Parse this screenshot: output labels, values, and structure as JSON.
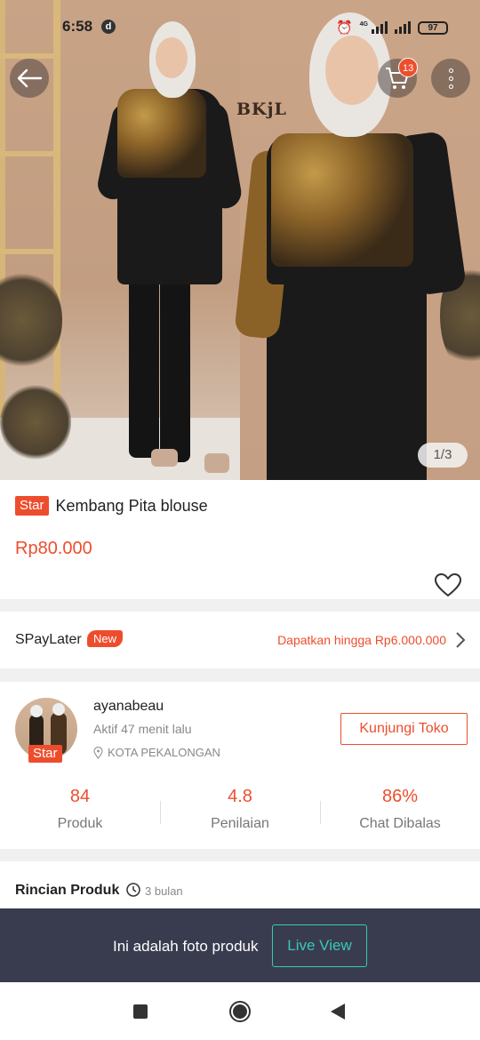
{
  "status_bar": {
    "time": "6:58",
    "notification_letter": "d",
    "network": "4G",
    "battery": "97"
  },
  "gallery": {
    "brand_mark": "BKjL",
    "counter": "1/3"
  },
  "header": {
    "cart_count": "13"
  },
  "product": {
    "badge": "Star",
    "title": "Kembang Pita blouse",
    "price": "Rp80.000"
  },
  "spaylater": {
    "label": "SPayLater",
    "badge": "New",
    "promo": "Dapatkan hingga Rp6.000.000"
  },
  "shop": {
    "name": "ayanabeau",
    "badge": "Star",
    "active": "Aktif 47 menit lalu",
    "location": "KOTA PEKALONGAN",
    "visit_label": "Kunjungi Toko",
    "stats": [
      {
        "value": "84",
        "label": "Produk"
      },
      {
        "value": "4.8",
        "label": "Penilaian"
      },
      {
        "value": "86%",
        "label": "Chat Dibalas"
      }
    ]
  },
  "details": {
    "title": "Rincian Produk",
    "age": "3 bulan"
  },
  "live_banner": {
    "text": "Ini adalah foto produk",
    "button": "Live View"
  },
  "colors": {
    "accent": "#ee4d2d",
    "banner_bg": "#393c4f",
    "live_teal": "#37c9b7"
  }
}
